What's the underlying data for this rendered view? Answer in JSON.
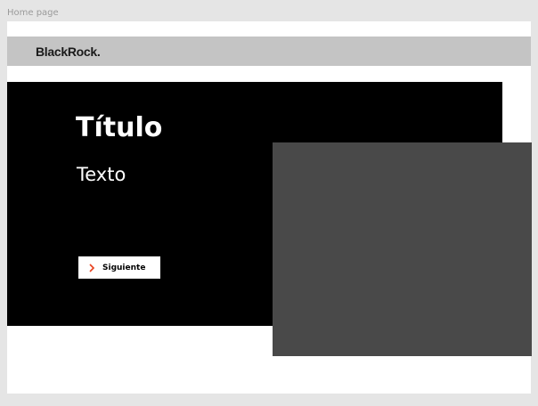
{
  "frame": {
    "label": "Home page"
  },
  "header": {
    "logo_text": "BlackRock."
  },
  "hero": {
    "title": "Título",
    "text": "Texto",
    "button_label": "Siguiente"
  },
  "colors": {
    "page_bg": "#e5e5e5",
    "header_bg": "#c4c4c4",
    "hero_bg": "#000000",
    "media_placeholder": "#494949",
    "accent": "#e8401c"
  },
  "icons": {
    "button_icon": "chevron-right-icon"
  }
}
